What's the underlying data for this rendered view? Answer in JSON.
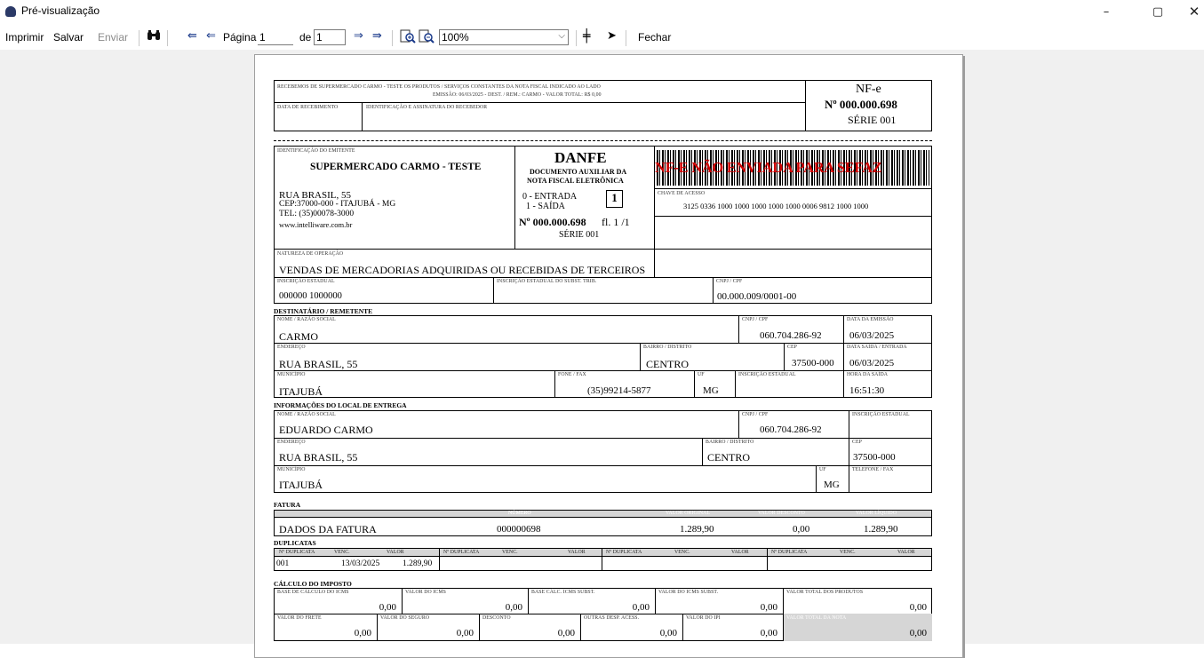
{
  "window": {
    "title": "Pré-visualização",
    "min_glyph": "–",
    "max_glyph": "▢",
    "close_glyph": "✕"
  },
  "toolbar": {
    "print": "Imprimir",
    "save": "Salvar",
    "send": "Enviar",
    "page_label": "Página",
    "page_value": "1",
    "of_label": "de",
    "page_total": "1",
    "zoom": "100%",
    "close": "Fechar",
    "icons": {
      "find": "binoculars-icon",
      "first": "first-page-icon",
      "prev": "previous-page-icon",
      "next": "next-page-icon",
      "last": "last-page-icon",
      "zoom_in": "zoom-in-icon",
      "zoom_out": "zoom-out-icon",
      "move": "move-icon",
      "pointer": "pointer-icon"
    }
  },
  "canhoto": {
    "line1": "RECEBEMOS DE SUPERMERCADO CARMO - TESTE OS PRODUTOS / SERVIÇOS CONSTANTES DA NOTA FISCAL INDICADO AO LADO",
    "line2": "EMISSÃO: 06/03/2025  -  DEST. / REM.: CARMO  -  VALOR TOTAL: R$ 0,00",
    "received_date_label": "DATA DE RECEBIMENTO",
    "signature_label": "IDENTIFICAÇÃO E ASSINATURA DO RECEBEDOR",
    "nfe_label": "NF-e",
    "number": "Nº 000.000.698",
    "series": "SÉRIE 001"
  },
  "emitter": {
    "section_label": "IDENTIFICAÇÃO DO EMITENTE",
    "name": "SUPERMERCADO CARMO - TESTE",
    "address": "RUA BRASIL, 55",
    "cep_city": "CEP:37000-000 - ITAJUBÁ - MG",
    "phone": "TEL: (35)00078-3000",
    "site": "www.intelliware.com.br"
  },
  "danfe": {
    "title": "DANFE",
    "subtitle1": "DOCUMENTO AUXILIAR DA",
    "subtitle2": "NOTA FISCAL ELETRÔNICA",
    "entry": "0 - ENTRADA",
    "exit": "1 - SAÍDA",
    "type_value": "1",
    "number": "Nº 000.000.698",
    "sheet": "fl. 1 /1",
    "series": "SÉRIE 001"
  },
  "barcode": {
    "overlay": "NF-E NÃO ENVIADA PARA SEFAZ",
    "access_key_label": "CHAVE DE ACESSO",
    "access_key": "3125 0336 1000 1000 1000 1000 1000 0006 9812 1000 1000"
  },
  "operation": {
    "nature_label": "NATUREZA DE OPERAÇÃO",
    "nature": "VENDAS DE MERCADORIAS ADQUIRIDAS OU RECEBIDAS DE TERCEIROS",
    "ie_label": "INSCRIÇÃO ESTADUAL",
    "ie": "000000 1000000",
    "ie_subst_label": "INSCRIÇÃO ESTADUAL DO SUBST. TRIB.",
    "cnpj_label": "CNPJ / CPF",
    "cnpj": "00.000.009/0001-00"
  },
  "recipient": {
    "section": "DESTINATÁRIO / REMETENTE",
    "name_label": "NOME / RAZÃO SOCIAL",
    "name": "CARMO",
    "cnpj_label": "CNPJ / CPF",
    "cnpj": "060.704.286-92",
    "emission_label": "DATA DA EMISSÃO",
    "emission": "06/03/2025",
    "address_label": "ENDEREÇO",
    "address": "RUA BRASIL, 55",
    "district_label": "BAIRRO / DISTRITO",
    "district": "CENTRO",
    "cep_label": "CEP",
    "cep": "37500-000",
    "exit_date_label": "DATA SAÍDA / ENTRADA",
    "exit_date": "06/03/2025",
    "city_label": "MUNICÍPIO",
    "city": "ITAJUBÁ",
    "phone_label": "FONE / FAX",
    "phone": "(35)99214-5877",
    "uf_label": "UF",
    "uf": "MG",
    "ie_label": "INSCRIÇÃO ESTADUAL",
    "exit_time_label": "HORA DA SAÍDA",
    "exit_time": "16:51:30"
  },
  "delivery": {
    "section": "INFORMAÇÕES DO LOCAL DE ENTREGA",
    "name_label": "NOME / RAZÃO SOCIAL",
    "name": "EDUARDO CARMO",
    "cnpj_label": "CNPJ / CPF",
    "cnpj": "060.704.286-92",
    "ie_label": "INSCRIÇÃO ESTADUAL",
    "address_label": "ENDEREÇO",
    "address": "RUA BRASIL, 55",
    "district_label": "BAIRRO / DISTRITO",
    "district": "CENTRO",
    "cep_label": "CEP",
    "cep": "37500-000",
    "city_label": "MUNICÍPIO",
    "city": "ITAJUBÁ",
    "uf_label": "UF",
    "uf": "MG",
    "phone_label": "TELEFONE / FAX"
  },
  "invoice": {
    "section": "FATURA",
    "number_label": "NÚMERO",
    "original_label": "VALOR ORIGINAL",
    "discount_label": "VALOR DESCONTO",
    "net_label": "VALOR LÍQUIDO",
    "desc": "DADOS DA FATURA",
    "number": "000000698",
    "original": "1.289,90",
    "discount": "0,00",
    "net": "1.289,90"
  },
  "duplicates": {
    "section": "DUPLICATAS",
    "headers": [
      "Nº DUPLICATA",
      "VENC.",
      "VALOR",
      "Nº DUPLICATA",
      "VENC.",
      "VALOR",
      "Nº DUPLICATA",
      "VENC.",
      "VALOR",
      "Nº DUPLICATA",
      "VENC.",
      "VALOR"
    ],
    "row": {
      "number": "001",
      "due": "13/03/2025",
      "value": "1.289,90"
    }
  },
  "tax": {
    "section": "CÁLCULO DO IMPOSTO",
    "row1": [
      {
        "label": "BASE DE CÁLCULO DO ICMS",
        "value": "0,00"
      },
      {
        "label": "VALOR DO ICMS",
        "value": "0,00"
      },
      {
        "label": "BASE CÁLC. ICMS SUBST.",
        "value": "0,00"
      },
      {
        "label": "VALOR DO ICMS SUBST.",
        "value": "0,00"
      },
      {
        "label": "VALOR TOTAL DOS PRODUTOS",
        "value": "0,00"
      }
    ],
    "row2": [
      {
        "label": "VALOR DO FRETE",
        "value": "0,00"
      },
      {
        "label": "VALOR DO SEGURO",
        "value": "0,00"
      },
      {
        "label": "DESCONTO",
        "value": "0,00"
      },
      {
        "label": "OUTRAS DESP. ACESS.",
        "value": "0,00"
      },
      {
        "label": "VALOR DO IPI",
        "value": "0,00"
      },
      {
        "label": "VALOR TOTAL DA NOTA",
        "value": "0,00"
      }
    ]
  }
}
